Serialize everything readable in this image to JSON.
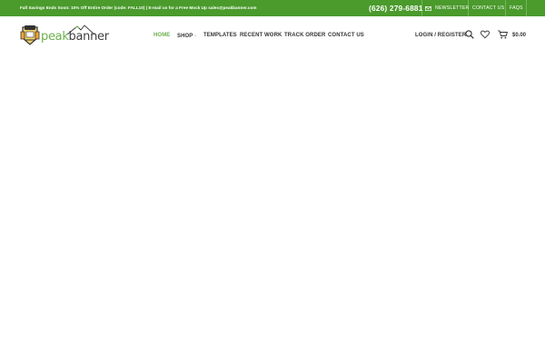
{
  "topbar": {
    "promo": "Fall Savings Ends Soon: 10% Off Entire Order (code: FALL10) | E-mail us for a Free Mock Up sales@peakbanner.com",
    "phone": "(626) 279-6881",
    "links": [
      "NEWSLETTER",
      "CONTACT US",
      "FAQS"
    ],
    "background": "#4a9a2c"
  },
  "logo": {
    "word_left": "peak",
    "word_right": "banner",
    "accent": "#6ab04c"
  },
  "nav": {
    "items": [
      {
        "label": "HOME",
        "active": true
      },
      {
        "label": "SHOP",
        "has_dropdown": true
      },
      {
        "label": "TEMPLATES"
      },
      {
        "label": "RECENT WORK"
      },
      {
        "label": "TRACK ORDER"
      },
      {
        "label": "CONTACT US"
      }
    ]
  },
  "header_actions": {
    "login": "LOGIN / REGISTER",
    "search_icon": "search-icon",
    "wishlist_icon": "heart-icon",
    "cart_icon": "cart-icon",
    "cart_total": "$0.00"
  }
}
